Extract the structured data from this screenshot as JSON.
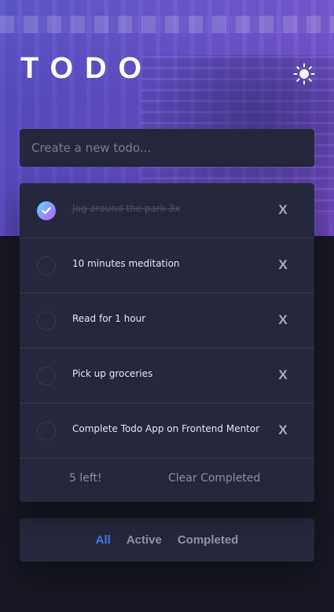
{
  "app": {
    "title": "TODO"
  },
  "new_todo": {
    "placeholder": "Create a new todo..."
  },
  "todos": [
    {
      "text": "Jog around the park 3x",
      "completed": true
    },
    {
      "text": "10 minutes meditation",
      "completed": false
    },
    {
      "text": "Read for 1 hour",
      "completed": false
    },
    {
      "text": "Pick up groceries",
      "completed": false
    },
    {
      "text": "Complete Todo App on Frontend Mentor",
      "completed": false
    }
  ],
  "delete_label": "X",
  "footer": {
    "items_left": "5 left!",
    "clear_completed": "Clear Completed"
  },
  "filters": {
    "all": "All",
    "active": "Active",
    "completed": "Completed",
    "selected": "all"
  },
  "icons": {
    "theme_toggle": "sun-icon",
    "check": "check-icon"
  },
  "colors": {
    "active_filter": "#3a7cfd",
    "check_gradient_start": "#57ddff",
    "check_gradient_end": "#c058f3"
  }
}
